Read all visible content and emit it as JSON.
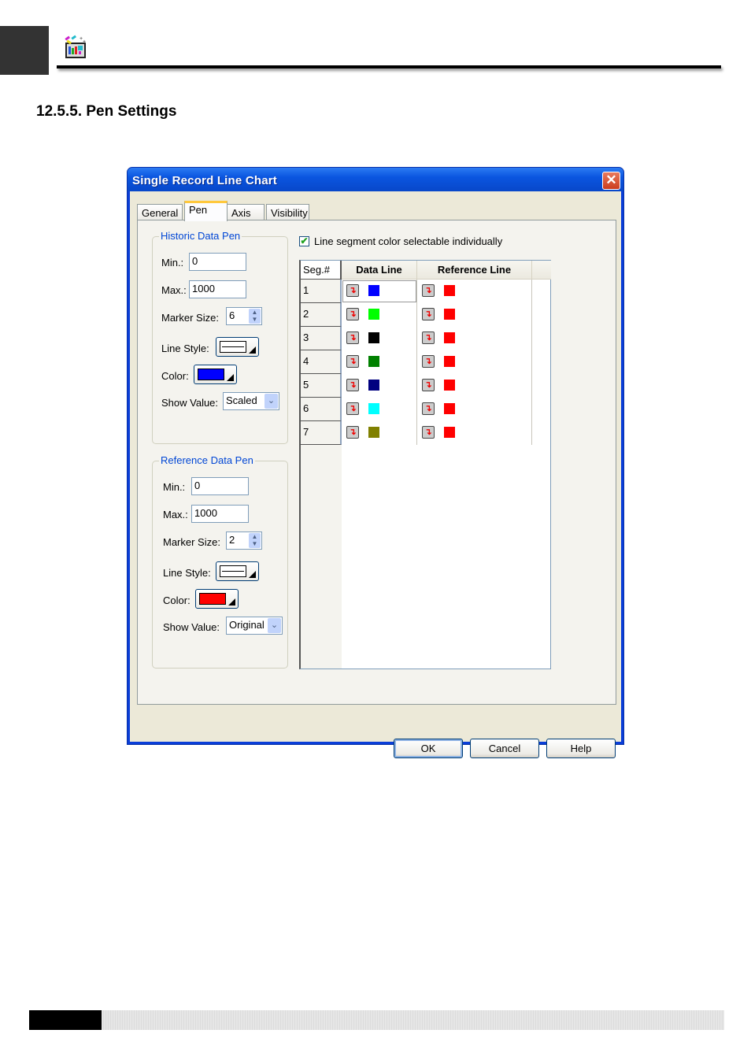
{
  "document": {
    "section_title": "12.5.5. Pen Settings",
    "header_icon": "chart-palette-icon"
  },
  "dialog": {
    "title": "Single Record Line Chart",
    "close_glyph": "✕",
    "tabs": [
      {
        "label": "General",
        "active": false
      },
      {
        "label": "Pen",
        "active": true
      },
      {
        "label": "Axis",
        "active": false
      },
      {
        "label": "Visibility",
        "active": false
      }
    ],
    "historic_pen": {
      "title": "Historic Data Pen",
      "min_label": "Min.:",
      "min_value": "0",
      "max_label": "Max.:",
      "max_value": "1000",
      "marker_size_label": "Marker Size:",
      "marker_size_value": "6",
      "line_style_label": "Line Style:",
      "color_label": "Color:",
      "color": "#0000ff",
      "show_value_label": "Show Value:",
      "show_value": "Scaled"
    },
    "reference_pen": {
      "title": "Reference Data Pen",
      "min_label": "Min.:",
      "min_value": "0",
      "max_label": "Max.:",
      "max_value": "1000",
      "marker_size_label": "Marker Size:",
      "marker_size_value": "2",
      "line_style_label": "Line Style:",
      "color_label": "Color:",
      "color": "#ff0000",
      "show_value_label": "Show Value:",
      "show_value": "Original"
    },
    "segment_color_checkbox": {
      "label": "Line segment color selectable individually",
      "checked": true,
      "glyph": "✔"
    },
    "grid": {
      "headers": {
        "seg": "Seg.#",
        "data": "Data Line",
        "ref": "Reference Line"
      },
      "rows": [
        {
          "seg": "1",
          "data_color": "#0000ff",
          "ref_color": "#ff0000"
        },
        {
          "seg": "2",
          "data_color": "#00ff00",
          "ref_color": "#ff0000"
        },
        {
          "seg": "3",
          "data_color": "#000000",
          "ref_color": "#ff0000"
        },
        {
          "seg": "4",
          "data_color": "#008000",
          "ref_color": "#ff0000"
        },
        {
          "seg": "5",
          "data_color": "#000080",
          "ref_color": "#ff0000"
        },
        {
          "seg": "6",
          "data_color": "#00ffff",
          "ref_color": "#ff0000"
        },
        {
          "seg": "7",
          "data_color": "#808000",
          "ref_color": "#ff0000"
        }
      ],
      "cell_button_glyph": "↴"
    },
    "buttons": {
      "ok": "OK",
      "cancel": "Cancel",
      "help": "Help"
    }
  }
}
